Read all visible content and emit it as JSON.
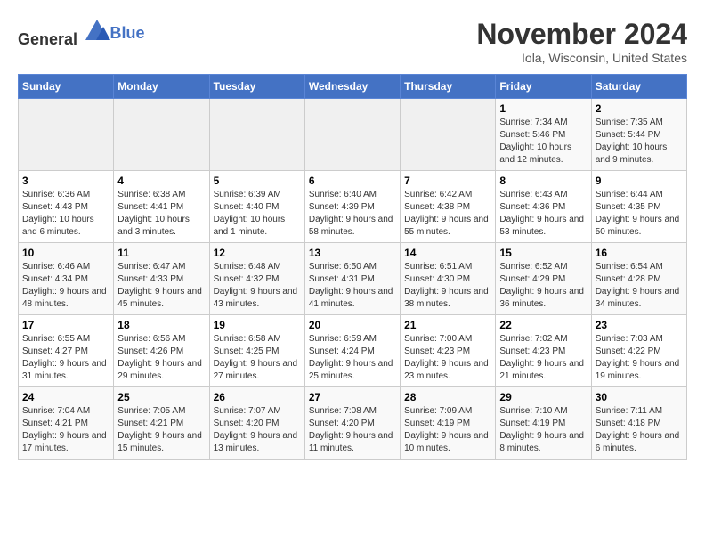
{
  "header": {
    "logo_general": "General",
    "logo_blue": "Blue",
    "month_year": "November 2024",
    "location": "Iola, Wisconsin, United States"
  },
  "days_of_week": [
    "Sunday",
    "Monday",
    "Tuesday",
    "Wednesday",
    "Thursday",
    "Friday",
    "Saturday"
  ],
  "weeks": [
    [
      {
        "day": "",
        "info": ""
      },
      {
        "day": "",
        "info": ""
      },
      {
        "day": "",
        "info": ""
      },
      {
        "day": "",
        "info": ""
      },
      {
        "day": "",
        "info": ""
      },
      {
        "day": "1",
        "info": "Sunrise: 7:34 AM\nSunset: 5:46 PM\nDaylight: 10 hours and 12 minutes."
      },
      {
        "day": "2",
        "info": "Sunrise: 7:35 AM\nSunset: 5:44 PM\nDaylight: 10 hours and 9 minutes."
      }
    ],
    [
      {
        "day": "3",
        "info": "Sunrise: 6:36 AM\nSunset: 4:43 PM\nDaylight: 10 hours and 6 minutes."
      },
      {
        "day": "4",
        "info": "Sunrise: 6:38 AM\nSunset: 4:41 PM\nDaylight: 10 hours and 3 minutes."
      },
      {
        "day": "5",
        "info": "Sunrise: 6:39 AM\nSunset: 4:40 PM\nDaylight: 10 hours and 1 minute."
      },
      {
        "day": "6",
        "info": "Sunrise: 6:40 AM\nSunset: 4:39 PM\nDaylight: 9 hours and 58 minutes."
      },
      {
        "day": "7",
        "info": "Sunrise: 6:42 AM\nSunset: 4:38 PM\nDaylight: 9 hours and 55 minutes."
      },
      {
        "day": "8",
        "info": "Sunrise: 6:43 AM\nSunset: 4:36 PM\nDaylight: 9 hours and 53 minutes."
      },
      {
        "day": "9",
        "info": "Sunrise: 6:44 AM\nSunset: 4:35 PM\nDaylight: 9 hours and 50 minutes."
      }
    ],
    [
      {
        "day": "10",
        "info": "Sunrise: 6:46 AM\nSunset: 4:34 PM\nDaylight: 9 hours and 48 minutes."
      },
      {
        "day": "11",
        "info": "Sunrise: 6:47 AM\nSunset: 4:33 PM\nDaylight: 9 hours and 45 minutes."
      },
      {
        "day": "12",
        "info": "Sunrise: 6:48 AM\nSunset: 4:32 PM\nDaylight: 9 hours and 43 minutes."
      },
      {
        "day": "13",
        "info": "Sunrise: 6:50 AM\nSunset: 4:31 PM\nDaylight: 9 hours and 41 minutes."
      },
      {
        "day": "14",
        "info": "Sunrise: 6:51 AM\nSunset: 4:30 PM\nDaylight: 9 hours and 38 minutes."
      },
      {
        "day": "15",
        "info": "Sunrise: 6:52 AM\nSunset: 4:29 PM\nDaylight: 9 hours and 36 minutes."
      },
      {
        "day": "16",
        "info": "Sunrise: 6:54 AM\nSunset: 4:28 PM\nDaylight: 9 hours and 34 minutes."
      }
    ],
    [
      {
        "day": "17",
        "info": "Sunrise: 6:55 AM\nSunset: 4:27 PM\nDaylight: 9 hours and 31 minutes."
      },
      {
        "day": "18",
        "info": "Sunrise: 6:56 AM\nSunset: 4:26 PM\nDaylight: 9 hours and 29 minutes."
      },
      {
        "day": "19",
        "info": "Sunrise: 6:58 AM\nSunset: 4:25 PM\nDaylight: 9 hours and 27 minutes."
      },
      {
        "day": "20",
        "info": "Sunrise: 6:59 AM\nSunset: 4:24 PM\nDaylight: 9 hours and 25 minutes."
      },
      {
        "day": "21",
        "info": "Sunrise: 7:00 AM\nSunset: 4:23 PM\nDaylight: 9 hours and 23 minutes."
      },
      {
        "day": "22",
        "info": "Sunrise: 7:02 AM\nSunset: 4:23 PM\nDaylight: 9 hours and 21 minutes."
      },
      {
        "day": "23",
        "info": "Sunrise: 7:03 AM\nSunset: 4:22 PM\nDaylight: 9 hours and 19 minutes."
      }
    ],
    [
      {
        "day": "24",
        "info": "Sunrise: 7:04 AM\nSunset: 4:21 PM\nDaylight: 9 hours and 17 minutes."
      },
      {
        "day": "25",
        "info": "Sunrise: 7:05 AM\nSunset: 4:21 PM\nDaylight: 9 hours and 15 minutes."
      },
      {
        "day": "26",
        "info": "Sunrise: 7:07 AM\nSunset: 4:20 PM\nDaylight: 9 hours and 13 minutes."
      },
      {
        "day": "27",
        "info": "Sunrise: 7:08 AM\nSunset: 4:20 PM\nDaylight: 9 hours and 11 minutes."
      },
      {
        "day": "28",
        "info": "Sunrise: 7:09 AM\nSunset: 4:19 PM\nDaylight: 9 hours and 10 minutes."
      },
      {
        "day": "29",
        "info": "Sunrise: 7:10 AM\nSunset: 4:19 PM\nDaylight: 9 hours and 8 minutes."
      },
      {
        "day": "30",
        "info": "Sunrise: 7:11 AM\nSunset: 4:18 PM\nDaylight: 9 hours and 6 minutes."
      }
    ]
  ]
}
